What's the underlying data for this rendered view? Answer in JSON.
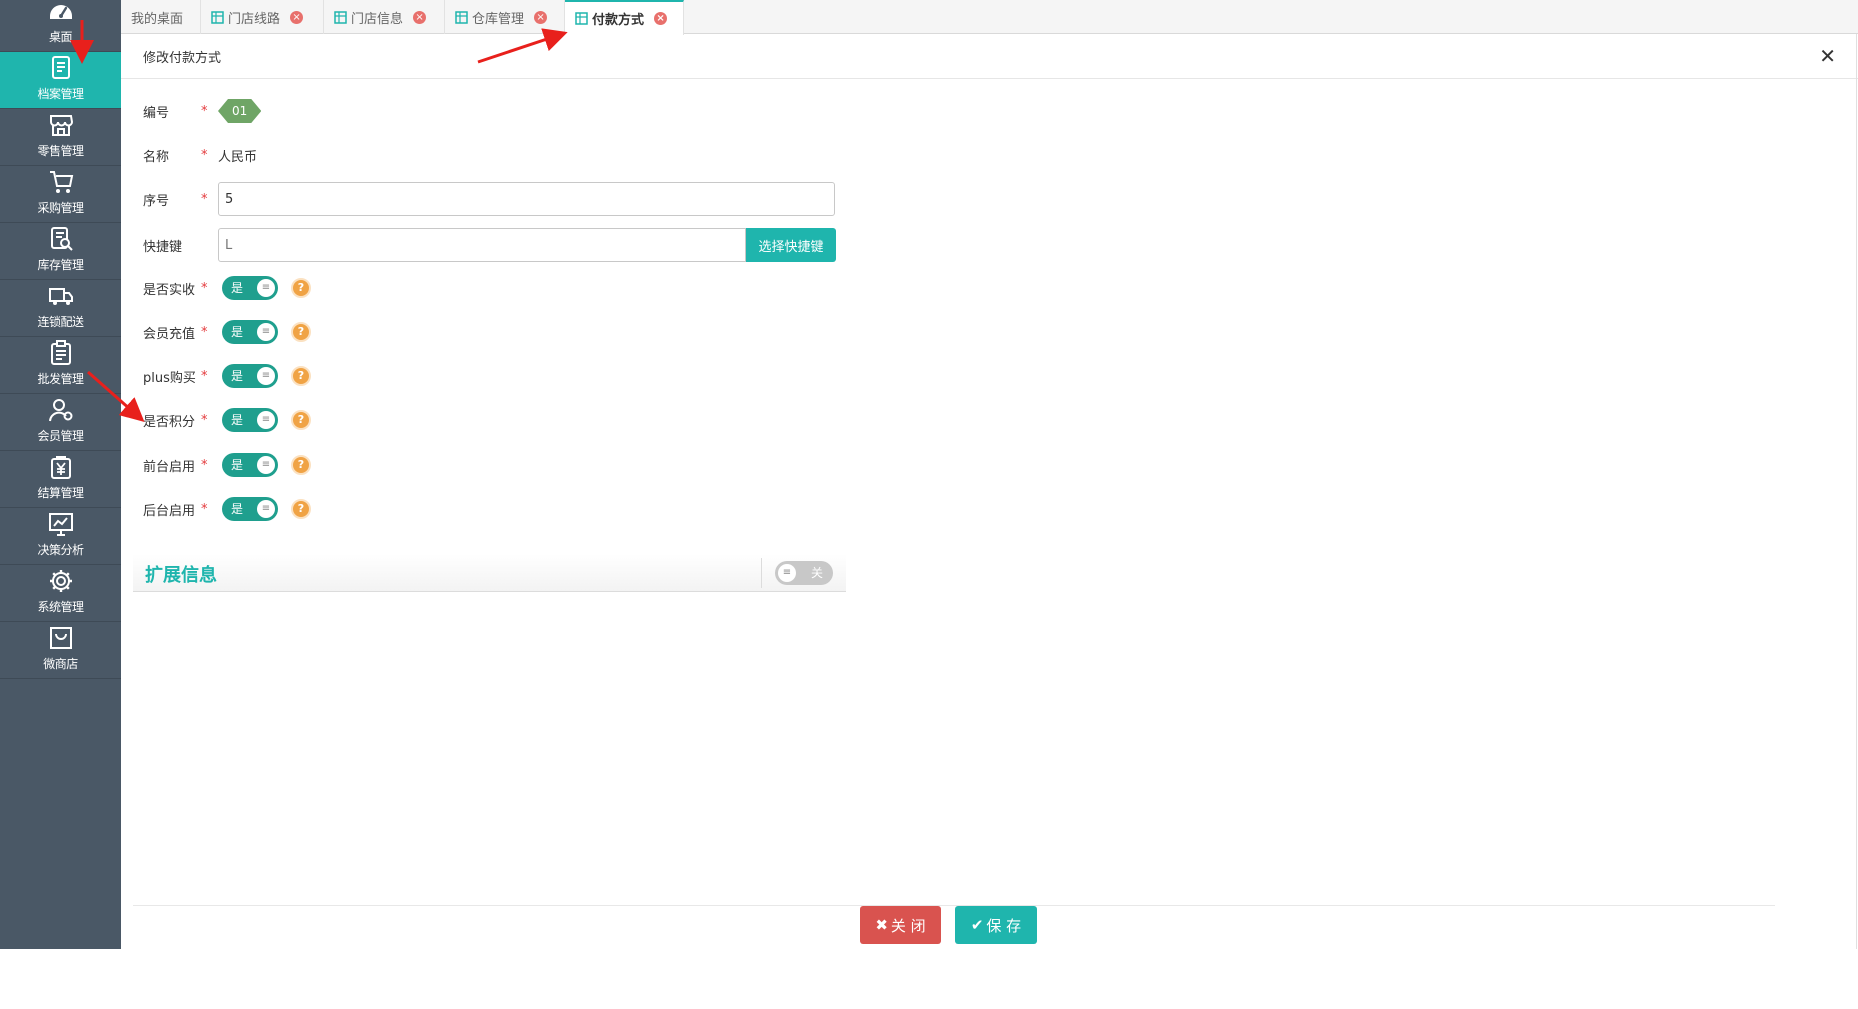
{
  "sidebar": {
    "items": [
      {
        "label": "桌面",
        "icon": "dashboard-icon"
      },
      {
        "label": "档案管理",
        "icon": "archive-icon"
      },
      {
        "label": "零售管理",
        "icon": "store-icon"
      },
      {
        "label": "采购管理",
        "icon": "cart-icon"
      },
      {
        "label": "库存管理",
        "icon": "inventory-icon"
      },
      {
        "label": "连锁配送",
        "icon": "truck-icon"
      },
      {
        "label": "批发管理",
        "icon": "clipboard-icon"
      },
      {
        "label": "会员管理",
        "icon": "user-icon"
      },
      {
        "label": "结算管理",
        "icon": "yen-icon"
      },
      {
        "label": "决策分析",
        "icon": "chart-icon"
      },
      {
        "label": "系统管理",
        "icon": "gear-icon"
      },
      {
        "label": "微商店",
        "icon": "bag-icon"
      }
    ],
    "active_color": "#1fb5ad"
  },
  "tabs": [
    {
      "label": "我的桌面"
    },
    {
      "label": "门店线路"
    },
    {
      "label": "门店信息"
    },
    {
      "label": "仓库管理"
    },
    {
      "label": "付款方式"
    }
  ],
  "panel": {
    "title": "修改付款方式",
    "close_symbol": "✕"
  },
  "form": {
    "code_label": "编号",
    "code_value": "01",
    "name_label": "名称",
    "name_value": "人民币",
    "seq_label": "序号",
    "seq_value": "5",
    "hotkey_label": "快捷键",
    "hotkey_value": "L",
    "hotkey_button": "选择快捷键",
    "required_mark": "*",
    "toggle_on_text": "是",
    "toggle_off_text": "关",
    "help_symbol": "?",
    "toggles": [
      {
        "label": "是否实收"
      },
      {
        "label": "会员充值"
      },
      {
        "label": "plus购买"
      },
      {
        "label": "是否积分"
      },
      {
        "label": "前台启用"
      },
      {
        "label": "后台启用"
      }
    ]
  },
  "extended": {
    "title": "扩展信息"
  },
  "footer": {
    "close_label": "关 闭",
    "save_label": "保 存"
  },
  "colors": {
    "accent": "#1fb5ad",
    "sidebar_bg": "#4a5866",
    "danger": "#d9534f",
    "help": "#f0a345",
    "badge": "#6fa566"
  }
}
